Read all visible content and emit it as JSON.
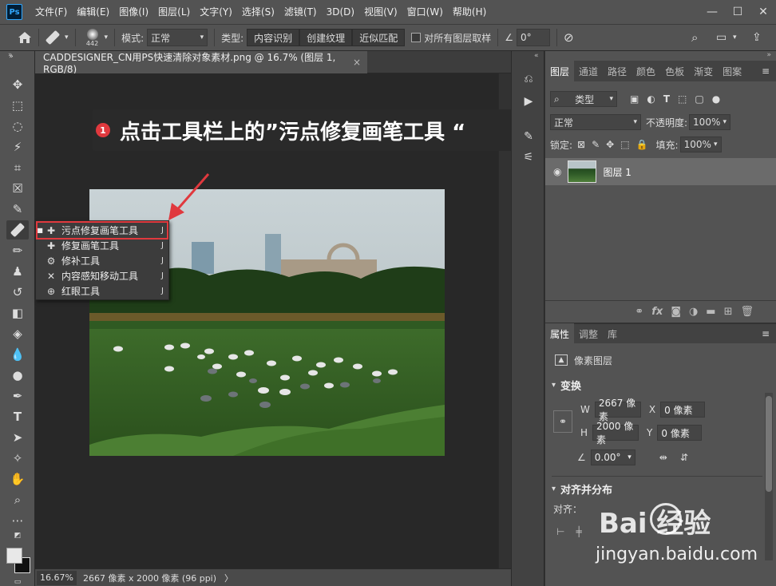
{
  "app": {
    "logo": "Ps",
    "menus": [
      "文件(F)",
      "编辑(E)",
      "图像(I)",
      "图层(L)",
      "文字(Y)",
      "选择(S)",
      "滤镜(T)",
      "3D(D)",
      "视图(V)",
      "窗口(W)",
      "帮助(H)"
    ],
    "window_controls": [
      "—",
      "☐",
      "✕"
    ]
  },
  "options": {
    "brush_size": "442",
    "mode_label": "模式:",
    "mode_value": "正常",
    "type_label": "类型:",
    "type_buttons": [
      "内容识别",
      "创建纹理",
      "近似匹配"
    ],
    "sample_all_label": "对所有图层取样",
    "angle_value": "0°"
  },
  "document": {
    "tab_title": "CADDESIGNER_CN用PS快速清除对象素材.png @ 16.7% (图层 1, RGB/8)",
    "tab_close": "×"
  },
  "status": {
    "zoom": "16.67%",
    "info": "2667 像素 x 2000 像素 (96 ppi)",
    "arrow": "〉"
  },
  "annotation": {
    "number": "1",
    "text": "点击工具栏上的”污点修复画笔工具 “"
  },
  "flyout": {
    "items": [
      {
        "label": "污点修复画笔工具",
        "key": "J",
        "icon": "spot-healing-brush-icon",
        "active": true
      },
      {
        "label": "修复画笔工具",
        "key": "J",
        "icon": "healing-brush-icon",
        "active": false
      },
      {
        "label": "修补工具",
        "key": "J",
        "icon": "patch-icon",
        "active": false
      },
      {
        "label": "内容感知移动工具",
        "key": "J",
        "icon": "content-aware-move-icon",
        "active": false
      },
      {
        "label": "红眼工具",
        "key": "J",
        "icon": "red-eye-icon",
        "active": false
      }
    ]
  },
  "layers_panel": {
    "tabs": [
      "图层",
      "通道",
      "路径",
      "颜色",
      "色板",
      "渐变",
      "图案"
    ],
    "filter_kind": "类型",
    "blend_mode": "正常",
    "opacity_label": "不透明度:",
    "opacity_value": "100%",
    "lock_label": "锁定:",
    "fill_label": "填充:",
    "fill_value": "100%",
    "layers": [
      {
        "name": "图层 1",
        "visible": true
      }
    ],
    "bottom_icons": [
      "link-icon",
      "fx-icon",
      "mask-icon",
      "adjustment-icon",
      "folder-icon",
      "new-layer-icon",
      "trash-icon"
    ],
    "fx_label": "fx"
  },
  "properties_panel": {
    "tabs": [
      "属性",
      "调整",
      "库"
    ],
    "kind_label": "像素图层",
    "transform_title": "变换",
    "w_label": "W",
    "w_value": "2667 像素",
    "h_label": "H",
    "h_value": "2000 像素",
    "x_label": "X",
    "x_value": "0 像素",
    "y_label": "Y",
    "y_value": "0 像素",
    "angle_value": "0.00°",
    "align_title": "对齐并分布",
    "align_label": "对齐："
  },
  "watermark": {
    "brand": "Bai  经验",
    "url": "jingyan.baidu.com"
  },
  "colors": {
    "accent_red": "#e0393e",
    "ps_blue": "#31a8ff"
  }
}
